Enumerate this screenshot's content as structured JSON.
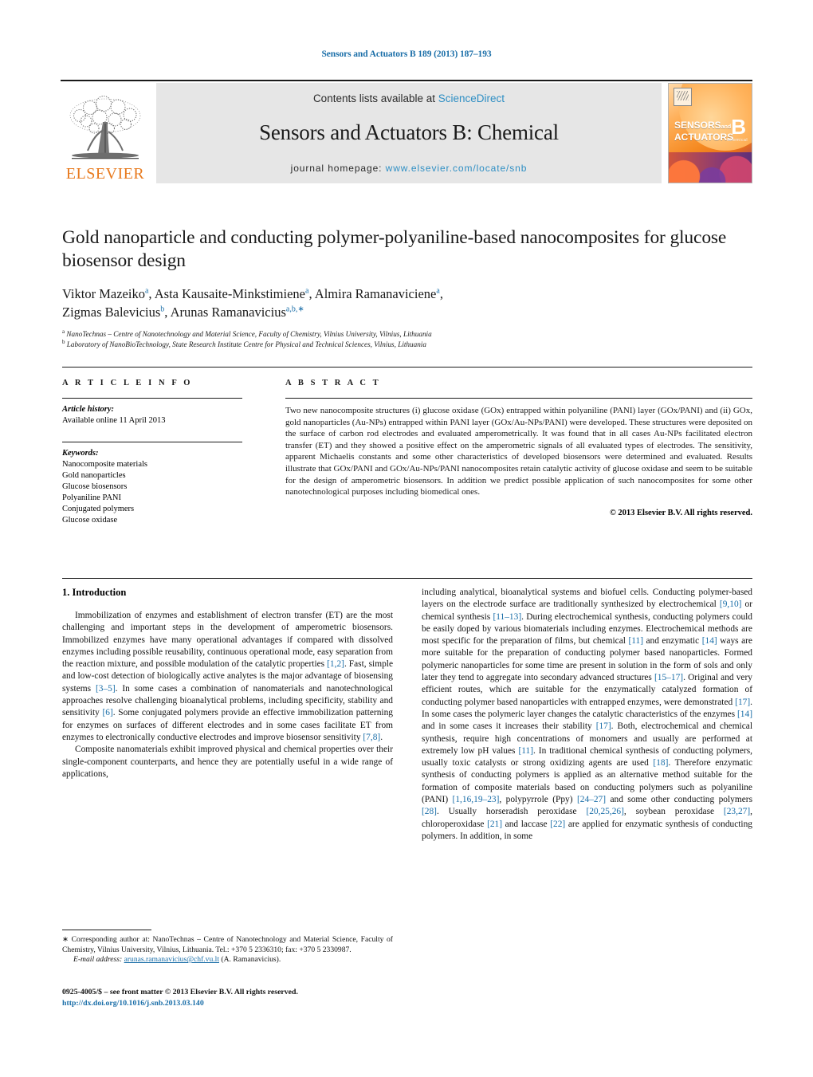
{
  "running_head": "Sensors and Actuators B 189 (2013) 187–193",
  "masthead": {
    "publisher_logo_text": "ELSEVIER",
    "contents_prefix": "Contents lists available at ",
    "contents_link": "ScienceDirect",
    "journal_name": "Sensors and Actuators B: Chemical",
    "homepage_prefix": "journal homepage: ",
    "homepage_url": "www.elsevier.com/locate/snb",
    "cover": {
      "line1": "SENSORS",
      "line1_small": "and",
      "line2": "ACTUATORS",
      "letter": "B",
      "letter_sub": "Chemical"
    }
  },
  "article": {
    "title": "Gold nanoparticle and conducting polymer-polyaniline-based nanocomposites for glucose biosensor design",
    "authors_line1_a": "Viktor Mazeiko",
    "authors_sup1": "a",
    "authors_line1_b": ", Asta Kausaite-Minkstimiene",
    "authors_sup2": "a",
    "authors_line1_c": ", Almira Ramanaviciene",
    "authors_sup3": "a",
    "authors_line1_d": ",",
    "authors_line2_a": "Zigmas Balevicius",
    "authors_sup4": "b",
    "authors_line2_b": ", Arunas Ramanavicius",
    "authors_sup5": "a,b,",
    "authors_sup5_star": "∗",
    "affiliation_a_mark": "a",
    "affiliation_a": "NanoTechnas – Centre of Nanotechnology and Material Science, Faculty of Chemistry, Vilnius University, Vilnius, Lithuania",
    "affiliation_b_mark": "b",
    "affiliation_b": "Laboratory of NanoBioTechnology, State Research Institute Centre for Physical and Technical Sciences, Vilnius, Lithuania"
  },
  "article_info": {
    "heading": "A R T I C L E  I N F O",
    "history_label": "Article history:",
    "history_value": "Available online 11 April 2013",
    "keywords_label": "Keywords:",
    "keywords": [
      "Nanocomposite materials",
      "Gold nanoparticles",
      "Glucose biosensors",
      "Polyaniline PANI",
      "Conjugated polymers",
      "Glucose oxidase"
    ]
  },
  "abstract": {
    "heading": "A B S T R A C T",
    "text": "Two new nanocomposite structures (i) glucose oxidase (GOx) entrapped within polyaniline (PANI) layer (GOx/PANI) and (ii) GOx, gold nanoparticles (Au-NPs) entrapped within PANI layer (GOx/Au-NPs/PANI) were developed. These structures were deposited on the surface of carbon rod electrodes and evaluated amperometrically. It was found that in all cases Au-NPs facilitated electron transfer (ET) and they showed a positive effect on the amperometric signals of all evaluated types of electrodes. The sensitivity, apparent Michaelis constants and some other characteristics of developed biosensors were determined and evaluated. Results illustrate that GOx/PANI and GOx/Au-NPs/PANI nanocomposites retain catalytic activity of glucose oxidase and seem to be suitable for the design of amperometric biosensors. In addition we predict possible application of such nanocomposites for some other nanotechnological purposes including biomedical ones.",
    "copyright": "© 2013 Elsevier B.V. All rights reserved."
  },
  "body": {
    "section_heading": "1. Introduction",
    "left_par1_a": "Immobilization of enzymes and establishment of electron transfer (ET) are the most challenging and important steps in the development of amperometric biosensors. Immobilized enzymes have many operational advantages if compared with dissolved enzymes including possible reusability, continuous operational mode, easy separation from the reaction mixture, and possible modulation of the catalytic properties ",
    "left_ref1": "[1,2]",
    "left_par1_b": ". Fast, simple and low-cost detection of biologically active analytes is the major advantage of biosensing systems ",
    "left_ref2": "[3–5]",
    "left_par1_c": ". In some cases a combination of nanomaterials and nanotechnological approaches resolve challenging bioanalytical problems, including specificity, stability and sensitivity ",
    "left_ref3": "[6]",
    "left_par1_d": ". Some conjugated polymers provide an effective immobilization patterning for enzymes on surfaces of different electrodes and in some cases facilitate ET from enzymes to electronically conductive electrodes and improve biosensor sensitivity ",
    "left_ref4": "[7,8]",
    "left_par1_e": ".",
    "left_par2": "Composite nanomaterials exhibit improved physical and chemical properties over their single-component counterparts, and hence they are potentially useful in a wide range of applications,",
    "right_par_a": "including analytical, bioanalytical systems and biofuel cells. Conducting polymer-based layers on the electrode surface are traditionally synthesized by electrochemical ",
    "right_ref1": "[9,10]",
    "right_par_b": " or chemical synthesis ",
    "right_ref2": "[11–13]",
    "right_par_c": ". During electrochemical synthesis, conducting polymers could be easily doped by various biomaterials including enzymes. Electrochemical methods are most specific for the preparation of films, but chemical ",
    "right_ref3": "[11]",
    "right_par_d": " and enzymatic ",
    "right_ref4": "[14]",
    "right_par_e": " ways are more suitable for the preparation of conducting polymer based nanoparticles. Formed polymeric nanoparticles for some time are present in solution in the form of sols and only later they tend to aggregate into secondary advanced structures ",
    "right_ref5": "[15–17]",
    "right_par_f": ". Original and very efficient routes, which are suitable for the enzymatically catalyzed formation of conducting polymer based nanoparticles with entrapped enzymes, were demonstrated ",
    "right_ref6": "[17]",
    "right_par_g": ". In some cases the polymeric layer changes the catalytic characteristics of the enzymes ",
    "right_ref7": "[14]",
    "right_par_h": " and in some cases it increases their stability ",
    "right_ref8": "[17]",
    "right_par_i": ". Both, electrochemical and chemical synthesis, require high concentrations of monomers and usually are performed at extremely low pH values ",
    "right_ref9": "[11]",
    "right_par_j": ". In traditional chemical synthesis of conducting polymers, usually toxic catalysts or strong oxidizing agents are used ",
    "right_ref10": "[18]",
    "right_par_k": ". Therefore enzymatic synthesis of conducting polymers is applied as an alternative method suitable for the formation of composite materials based on conducting polymers such as polyaniline (PANI) ",
    "right_ref11": "[1,16,19–23]",
    "right_par_l": ", polypyrrole (Ppy) ",
    "right_ref12": "[24–27]",
    "right_par_m": " and some other conducting polymers ",
    "right_ref13": "[28]",
    "right_par_n": ". Usually horseradish peroxidase ",
    "right_ref14": "[20,25,26]",
    "right_par_o": ", soybean peroxidase ",
    "right_ref15": "[23,27]",
    "right_par_p": ", chloroperoxidase ",
    "right_ref16": "[21]",
    "right_par_q": " and laccase ",
    "right_ref17": "[22]",
    "right_par_r": " are applied for enzymatic synthesis of conducting polymers. In addition, in some"
  },
  "footnote": {
    "star": "∗",
    "text": " Corresponding author at: NanoTechnas – Centre of Nanotechnology and Material Science, Faculty of Chemistry, Vilnius University, Vilnius, Lithuania. Tel.: +370 5 2336310; fax: +370 5 2330987.",
    "email_label": "E-mail address:",
    "email": "arunas.ramanavicius@chf.vu.lt",
    "email_suffix": " (A. Ramanavicius)."
  },
  "imprint": {
    "line1": "0925-4005/$ – see front matter © 2013 Elsevier B.V. All rights reserved.",
    "doi": "http://dx.doi.org/10.1016/j.snb.2013.03.140"
  },
  "colors": {
    "link": "#1a6ea8",
    "science_direct": "#2f8fc4",
    "elsevier_orange": "#e87a1e",
    "band_gray": "#e6e6e6"
  }
}
